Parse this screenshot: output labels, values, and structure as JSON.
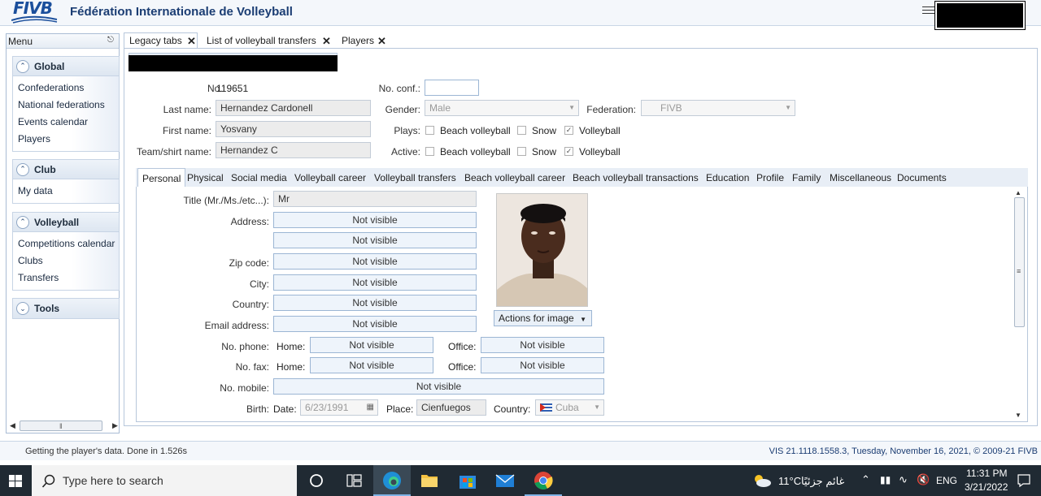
{
  "header": {
    "logo_text": "FIVB",
    "title": "Fédération Internationale de Volleyball"
  },
  "sidebar": {
    "title": "Menu",
    "groups": [
      {
        "title": "Global",
        "items": [
          "Confederations",
          "National federations",
          "Events calendar",
          "Players"
        ]
      },
      {
        "title": "Club",
        "items": [
          "My data"
        ]
      },
      {
        "title": "Volleyball",
        "items": [
          "Competitions calendar",
          "Clubs",
          "Transfers"
        ]
      },
      {
        "title": "Tools",
        "items": []
      }
    ]
  },
  "main_tabs": [
    {
      "label": "Legacy tabs"
    },
    {
      "label": "List of volleyball transfers"
    },
    {
      "label": "Players"
    }
  ],
  "player": {
    "no_label": "No.:",
    "no_value": "119651",
    "no_conf_label": "No. conf.:",
    "no_conf_value": "",
    "last_name_label": "Last name:",
    "last_name": "Hernandez Cardonell",
    "first_name_label": "First name:",
    "first_name": "Yosvany",
    "team_shirt_label": "Team/shirt name:",
    "team_shirt_name": "Hernandez C",
    "gender_label": "Gender:",
    "gender": "Male",
    "federation_label": "Federation:",
    "federation": "FIVB",
    "plays_label": "Plays:",
    "active_label": "Active:",
    "beach_label": "Beach volleyball",
    "snow_label": "Snow",
    "volleyball_label": "Volleyball",
    "plays": {
      "beach": false,
      "snow": false,
      "volleyball": true
    },
    "active": {
      "beach": false,
      "snow": false,
      "volleyball": true
    }
  },
  "detail_tabs": [
    "Personal",
    "Physical",
    "Social media",
    "Volleyball career",
    "Volleyball transfers",
    "Beach volleyball career",
    "Beach volleyball transactions",
    "Education",
    "Profile",
    "Family",
    "Miscellaneous",
    "Documents"
  ],
  "personal": {
    "title_label": "Title (Mr./Ms./etc...):",
    "title_value": "Mr",
    "address_label": "Address:",
    "address1": "Not visible",
    "address2": "Not visible",
    "zip_label": "Zip code:",
    "zip": "Not visible",
    "city_label": "City:",
    "city": "Not visible",
    "country_label": "Country:",
    "country": "Not visible",
    "email_label": "Email address:",
    "email": "Not visible",
    "phone_label": "No. phone:",
    "fax_label": "No. fax:",
    "home_label": "Home:",
    "office_label": "Office:",
    "phone_home": "Not visible",
    "phone_office": "Not visible",
    "fax_home": "Not visible",
    "fax_office": "Not visible",
    "mobile_label": "No. mobile:",
    "mobile": "Not visible",
    "birth_label": "Birth:",
    "date_label": "Date:",
    "birth_date": "6/23/1991",
    "place_label": "Place:",
    "birth_place": "Cienfuegos",
    "birth_country_label": "Country:",
    "birth_country": "Cuba",
    "actions_image": "Actions for image"
  },
  "status": {
    "left": "Getting the player's data. Done in 1.526s",
    "right": "VIS 21.1118.1558.3, Tuesday, November 16, 2021, © 2009-21 FIVB"
  },
  "taskbar": {
    "search_placeholder": "Type here to search",
    "weather": "11°C",
    "weather_text": "غائم جزئيًا",
    "lang": "ENG",
    "time": "11:31 PM",
    "date": "3/21/2022"
  },
  "colors": {
    "accent": "#1b4f9c",
    "panel_border": "#b7c7db",
    "taskbar": "#202a33"
  }
}
